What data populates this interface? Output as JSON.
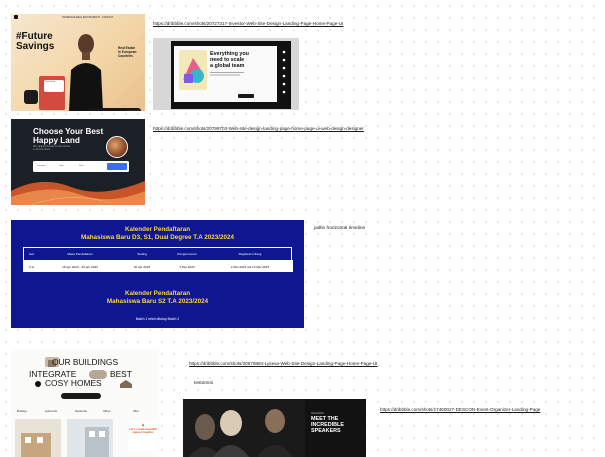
{
  "links": {
    "future_savings": "https://dribbble.com/shots/20727317-Investor-Web-Site-Design-Landing-Page-Home-Page-UI",
    "happy_land": "https://dribbble.com/shots/20799703-Web-site-design-landing-page-home-page-ui-web-design-designer",
    "buildings": "https://dribbble.com/shots/20676884-Lyseva-Web-Site-Design-Landing-Page-Home-Page-UI",
    "speakers": "https://dribbble.com/shots/17460027-DESCON-Event-Organizer-Landing-Page"
  },
  "notes": {
    "timeline": "jadlin horizontal timeline",
    "testimoni": "testomini"
  },
  "future_savings_card": {
    "nav": [
      "HOMEPAGE",
      "REAL ESTATE",
      "ABOUT",
      "CONTACT"
    ],
    "title_line1": "#Future",
    "title_line2": "Savings",
    "subtitle_line1": "Real Estate",
    "subtitle_line2": "In European",
    "subtitle_line3": "Countries",
    "widget_text": "Your Goals"
  },
  "everything_card": {
    "heading_line1": "Everything you",
    "heading_line2": "need to scale",
    "heading_line3": "a global team"
  },
  "happy_land_card": {
    "heading_line1": "Choose Your Best",
    "heading_line2": "Happy Land",
    "small_line1": "We Helped People to Get Home",
    "small_line2": "in All Countries",
    "search_fields": [
      "Location",
      "Type",
      "Price"
    ],
    "search_button": "Search"
  },
  "kalender": {
    "title_line1": "Kalender Pendaftaran",
    "title_line2": "Mahasiswa Baru D3, S1, Dual Degree T.A 2023/2024",
    "columns": [
      "Gel",
      "Masa Pendaftaran",
      "Testing",
      "Pengumuman",
      "Registrasi Ulang"
    ],
    "row": [
      "II-G",
      "15 apr 2023 - 30 apr 2023",
      "30 apr 2023",
      "2 Mei 2023",
      "2 Mei 2023 s/d 13 Mei 2023"
    ],
    "title2_line1": "Kalender Pendaftaran",
    "title2_line2": "Mahasiswa Baru S2 T.A 2023/2024",
    "footer": "Batch 1 telah ditutup Batch 2"
  },
  "buildings_card": {
    "line1": "OUR BUILDINGS",
    "line2a": "INTEGRATE",
    "line2b": "BEST",
    "line3": "COSY HOMES",
    "filters": [
      "Buildings",
      "Apartments",
      "Residential",
      "Offices",
      "Villas"
    ],
    "promo_line1": "Let's create beautiful",
    "promo_line2": "spaces together"
  },
  "speakers_card": {
    "small": "SPEAKERS",
    "heading_line1": "MEET THE",
    "heading_line2": "INCREDIBLE",
    "heading_line3": "SPEAKERS"
  }
}
